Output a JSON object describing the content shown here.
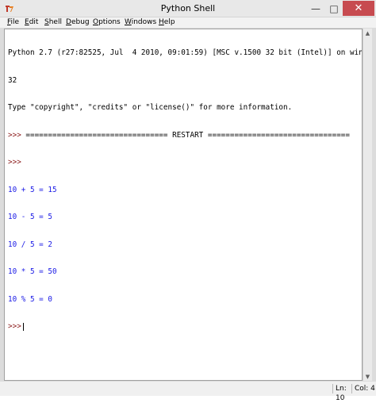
{
  "window": {
    "title": "Python Shell"
  },
  "menu": [
    "File",
    "Edit",
    "Shell",
    "Debug",
    "Options",
    "Windows",
    "Help"
  ],
  "shell": {
    "banner_line1": "Python 2.7 (r27:82525, Jul  4 2010, 09:01:59) [MSC v.1500 32 bit (Intel)] on win",
    "banner_line2": "32",
    "banner_line3": "Type \"copyright\", \"credits\" or \"license()\" for more information.",
    "prompt": ">>>",
    "restart_line": " ================================ RESTART ================================",
    "outputs": [
      "10 + 5 = 15",
      "10 - 5 = 5",
      "10 / 5 = 2",
      "10 * 5 = 50",
      "10 % 5 = 0"
    ]
  },
  "status": {
    "line": "Ln: 10",
    "col": "Col: 4"
  },
  "colors": {
    "prompt": "#8b1a1a",
    "output": "#1a1ae6",
    "close_button": "#c74b50"
  },
  "icons": {
    "app": "python-idle-icon",
    "minimize": "minimize-icon",
    "maximize": "maximize-icon",
    "close": "close-icon"
  }
}
